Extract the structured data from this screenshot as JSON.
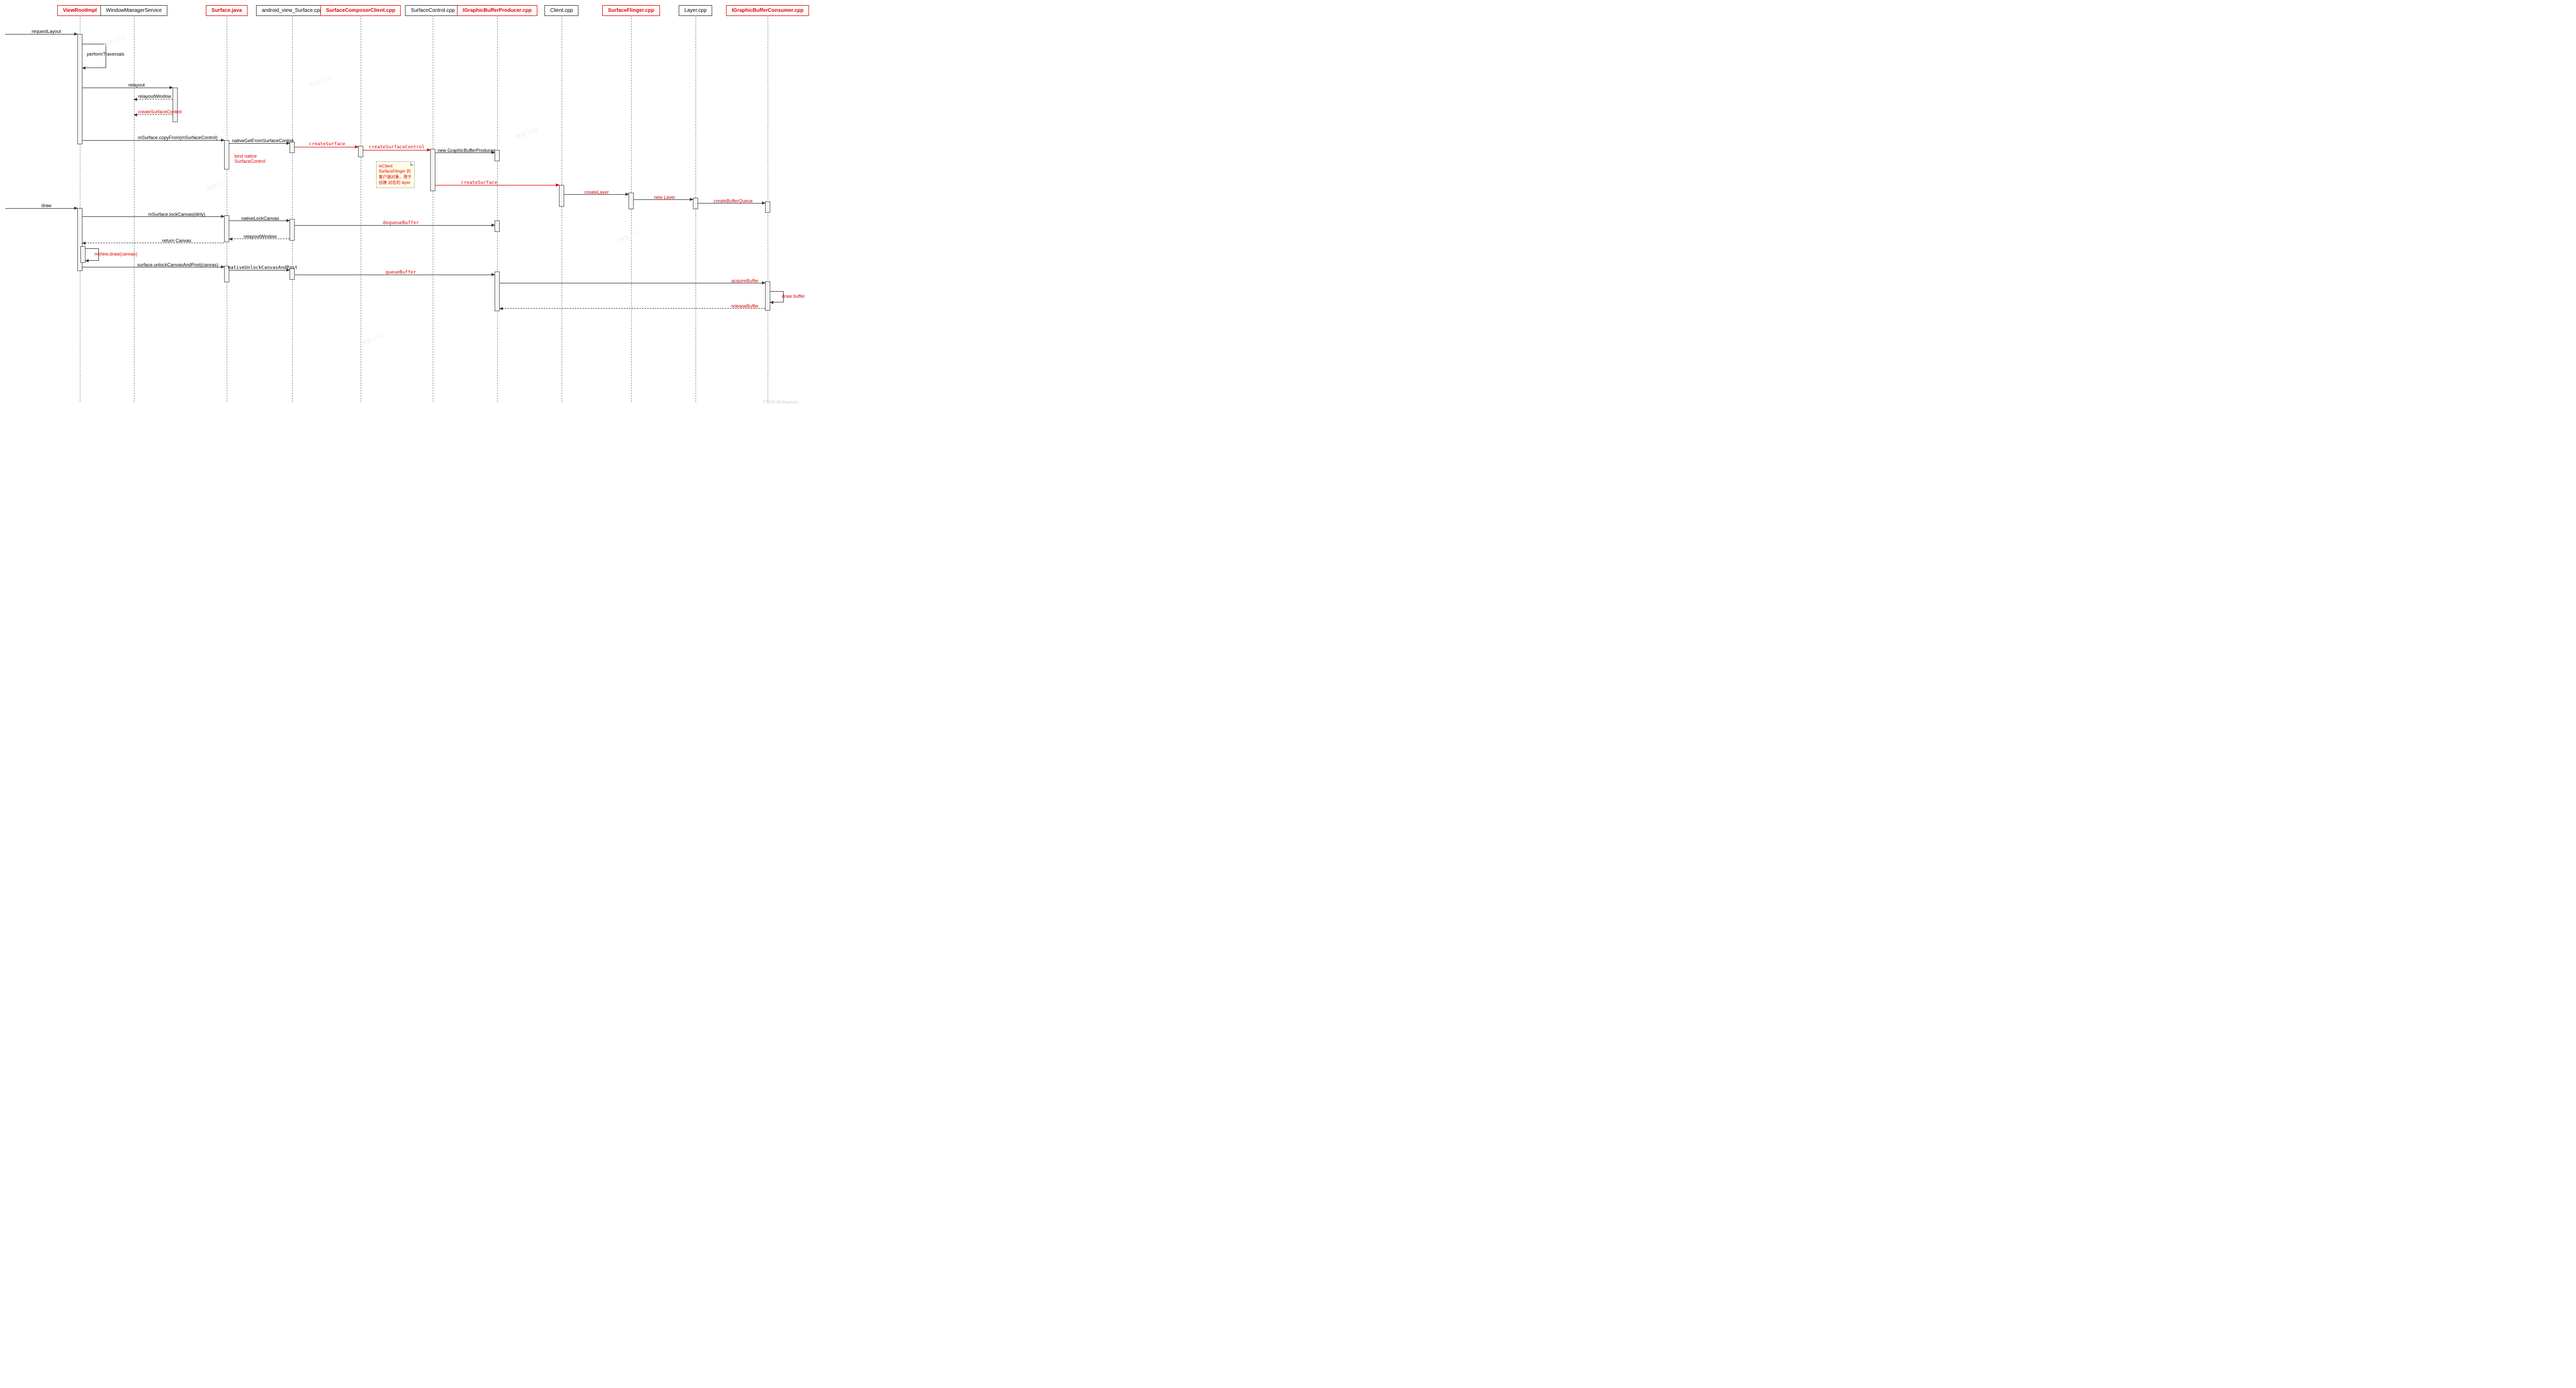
{
  "participants": {
    "p1": "ViewRootImpl",
    "p2": "WindowManagerService",
    "p3": "Surface.java",
    "p4": "android_view_Surface.cpp",
    "p5": "SurfaceComposerClient.cpp",
    "p6": "SurfaceControl.cpp",
    "p7": "IGraphicBufferProducer.cpp",
    "p8": "Client.cpp",
    "p9": "SurfaceFlinger.cpp",
    "p10": "Layer.cpp",
    "p11": "IGraphicBufferConsumer.cpp"
  },
  "messages": {
    "requestLayout": "requestLayout",
    "performTraversals": "performTraversals",
    "relayout": "relayout",
    "relayoutWindow": "relayoutWindow",
    "createSurfaceControl": "createSurfaceControl",
    "copyFrom": "mSurface.copyFrom(mSurfaceControl)",
    "nativeGetFrom": "nativeGetFromSurfaceControl",
    "createSurface": "createSurface",
    "createSurfaceControl2": "createSurfaceControl",
    "newGBP": "new GraphicBufferProducer",
    "bindNative": "bind natice SurfaceControl",
    "noteText": "mClient SurfaceFlinger 的客户端对象，用于创建 对应的 layer",
    "createSurface2": "createSurface",
    "createLayer": "createLayer",
    "newLayer": "new Layer",
    "createBufferQueue": "createBufferQueue",
    "draw": "draw",
    "lockCanvas": "mSurface.lockCanvas(dirty)",
    "nativeLockCanvas": "nativeLockCanvas",
    "dequeueBuffer": "dequeueBuffer",
    "relayoutWindow2": "relayoutWindow",
    "returnCanvas": "return Canvas",
    "viewDraw": "mView.draw(canvas)",
    "unlockPost": "surface.unlockCanvasAndPost(canvas)",
    "nativeUnlock": "nativeUnlockCanvasAndPost",
    "queueBuffer": "queueBuffer",
    "acquireBuffer": "acquireBuffer",
    "drawBuffer": "draw buffer",
    "releaseBuffer": "releaseBuffer"
  },
  "watermark": "微信 1731",
  "credit": "CSDN @whywhom"
}
